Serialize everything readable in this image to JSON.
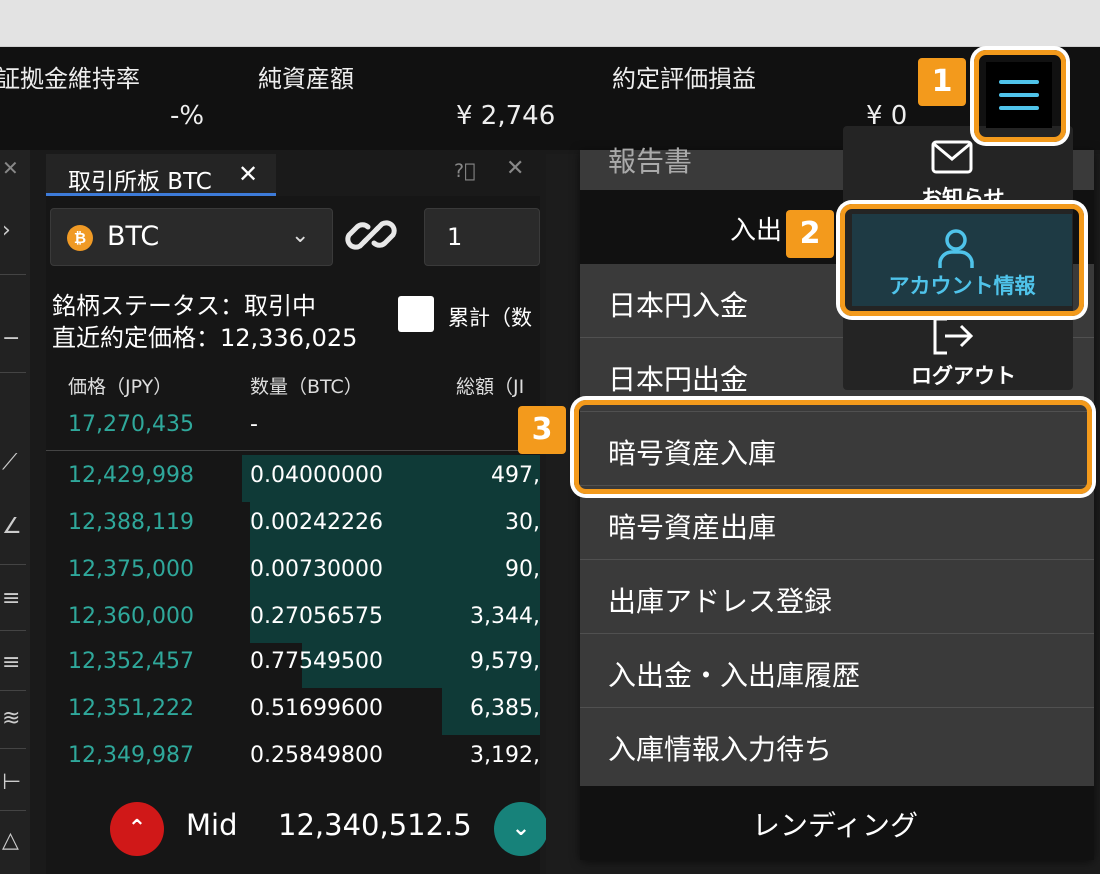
{
  "summary": {
    "margin_ratio_label": "証拠金維持率",
    "margin_ratio_value": "-%",
    "net_assets_label": "純資産額",
    "net_assets_value": "¥ 2,746",
    "pnl_label": "約定評価損益",
    "pnl_value": "¥ 0"
  },
  "board": {
    "tab_label": "取引所板 BTC",
    "tab_close": "✕",
    "symbol": "BTC",
    "coin_icon": "bitcoin-icon",
    "quantity": "1",
    "status_line": "銘柄ステータス：取引中",
    "last_price_line": "直近約定価格：12,336,025",
    "cumulative_label": "累計（数",
    "headers": {
      "price": "価格（JPY）",
      "amount": "数量（BTC）",
      "total": "総額（JI"
    },
    "top_row": {
      "price": "17,270,435",
      "amount": "-"
    },
    "rows": [
      {
        "price": "12,429,998",
        "amount": "0.04000000",
        "total": "497,"
      },
      {
        "price": "12,388,119",
        "amount": "0.00242226",
        "total": "30,"
      },
      {
        "price": "12,375,000",
        "amount": "0.00730000",
        "total": "90,"
      },
      {
        "price": "12,360,000",
        "amount": "0.27056575",
        "total": "3,344,"
      },
      {
        "price": "12,352,457",
        "amount": "0.77549500",
        "total": "9,579,"
      },
      {
        "price": "12,351,222",
        "amount": "0.51699600",
        "total": "6,385,"
      },
      {
        "price": "12,349,987",
        "amount": "0.25849800",
        "total": "3,192,"
      }
    ],
    "mid_label": "Mid",
    "mid_value": "12,340,512.5"
  },
  "menu": {
    "partial_top": "報告書",
    "section_header": "入出",
    "items": [
      "日本円入金",
      "日本円出金",
      "暗号資産入庫",
      "暗号資産出庫",
      "出庫アドレス登録",
      "入出金・入出庫履歴",
      "入庫情報入力待ち"
    ],
    "footer": "レンディング"
  },
  "popup": {
    "notice_label": "お知らせ",
    "account_label": "アカウント情報",
    "logout_label": "ログアウト"
  },
  "badges": [
    "1",
    "2",
    "3"
  ],
  "colors": {
    "highlight": "#f39a1c",
    "bid_price": "#2fa89b",
    "depth_bar": "#0f3a37",
    "account_text": "#4fc3ea",
    "tab_accent": "#3d7bd9"
  }
}
